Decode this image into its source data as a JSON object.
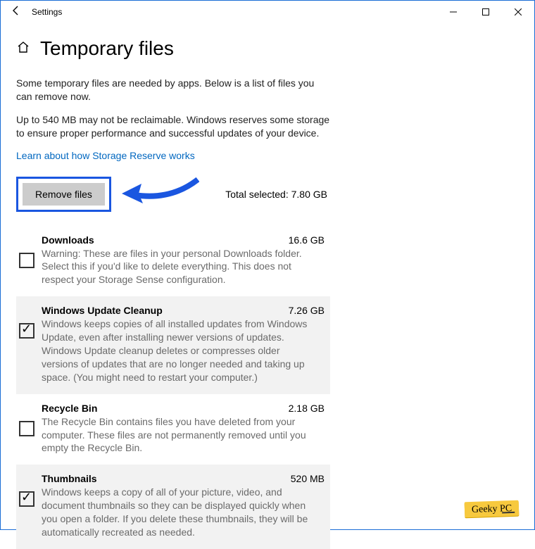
{
  "window": {
    "title": "Settings"
  },
  "page": {
    "heading": "Temporary files",
    "intro1": "Some temporary files are needed by apps. Below is a list of files you can remove now.",
    "intro2": "Up to 540 MB may not be reclaimable. Windows reserves some storage to ensure proper performance and successful updates of your device.",
    "link": "Learn about how Storage Reserve works",
    "remove_label": "Remove files",
    "total_label": "Total selected: 7.80 GB"
  },
  "items": [
    {
      "title": "Downloads",
      "size": "16.6 GB",
      "desc": "Warning: These are files in your personal Downloads folder. Select this if you'd like to delete everything. This does not respect your Storage Sense configuration.",
      "checked": false
    },
    {
      "title": "Windows Update Cleanup",
      "size": "7.26 GB",
      "desc": "Windows keeps copies of all installed updates from Windows Update, even after installing newer versions of updates. Windows Update cleanup deletes or compresses older versions of updates that are no longer needed and taking up space. (You might need to restart your computer.)",
      "checked": true
    },
    {
      "title": "Recycle Bin",
      "size": "2.18 GB",
      "desc": "The Recycle Bin contains files you have deleted from your computer. These files are not permanently removed until you empty the Recycle Bin.",
      "checked": false
    },
    {
      "title": "Thumbnails",
      "size": "520 MB",
      "desc": "Windows keeps a copy of all of your picture, video, and document thumbnails so they can be displayed quickly when you open a folder. If you delete these thumbnails, they will be automatically recreated as needed.",
      "checked": true
    }
  ],
  "watermark": "Geeky PC"
}
